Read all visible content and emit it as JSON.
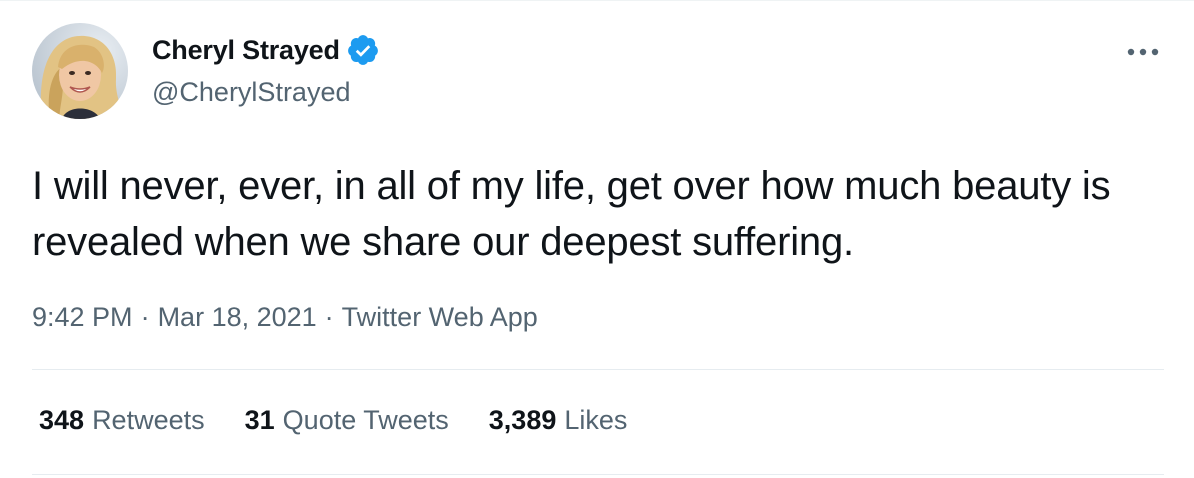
{
  "author": {
    "display_name": "Cheryl Strayed",
    "handle": "@CherylStrayed",
    "verified_icon": "verified-badge-icon",
    "avatar_icon": "avatar"
  },
  "tweet": {
    "text": "I will never, ever, in all of my life, get over how much beauty is revealed when we share our deepest suffering."
  },
  "meta": {
    "time": "9:42 PM",
    "separator": "·",
    "date": "Mar 18, 2021",
    "source": "Twitter Web App"
  },
  "stats": [
    {
      "count": "348",
      "label": "Retweets"
    },
    {
      "count": "31",
      "label": "Quote Tweets"
    },
    {
      "count": "3,389",
      "label": "Likes"
    }
  ],
  "colors": {
    "accent": "#1d9bf0",
    "text_primary": "#0f1419",
    "text_secondary": "#536471",
    "divider": "#e6ecf0"
  }
}
